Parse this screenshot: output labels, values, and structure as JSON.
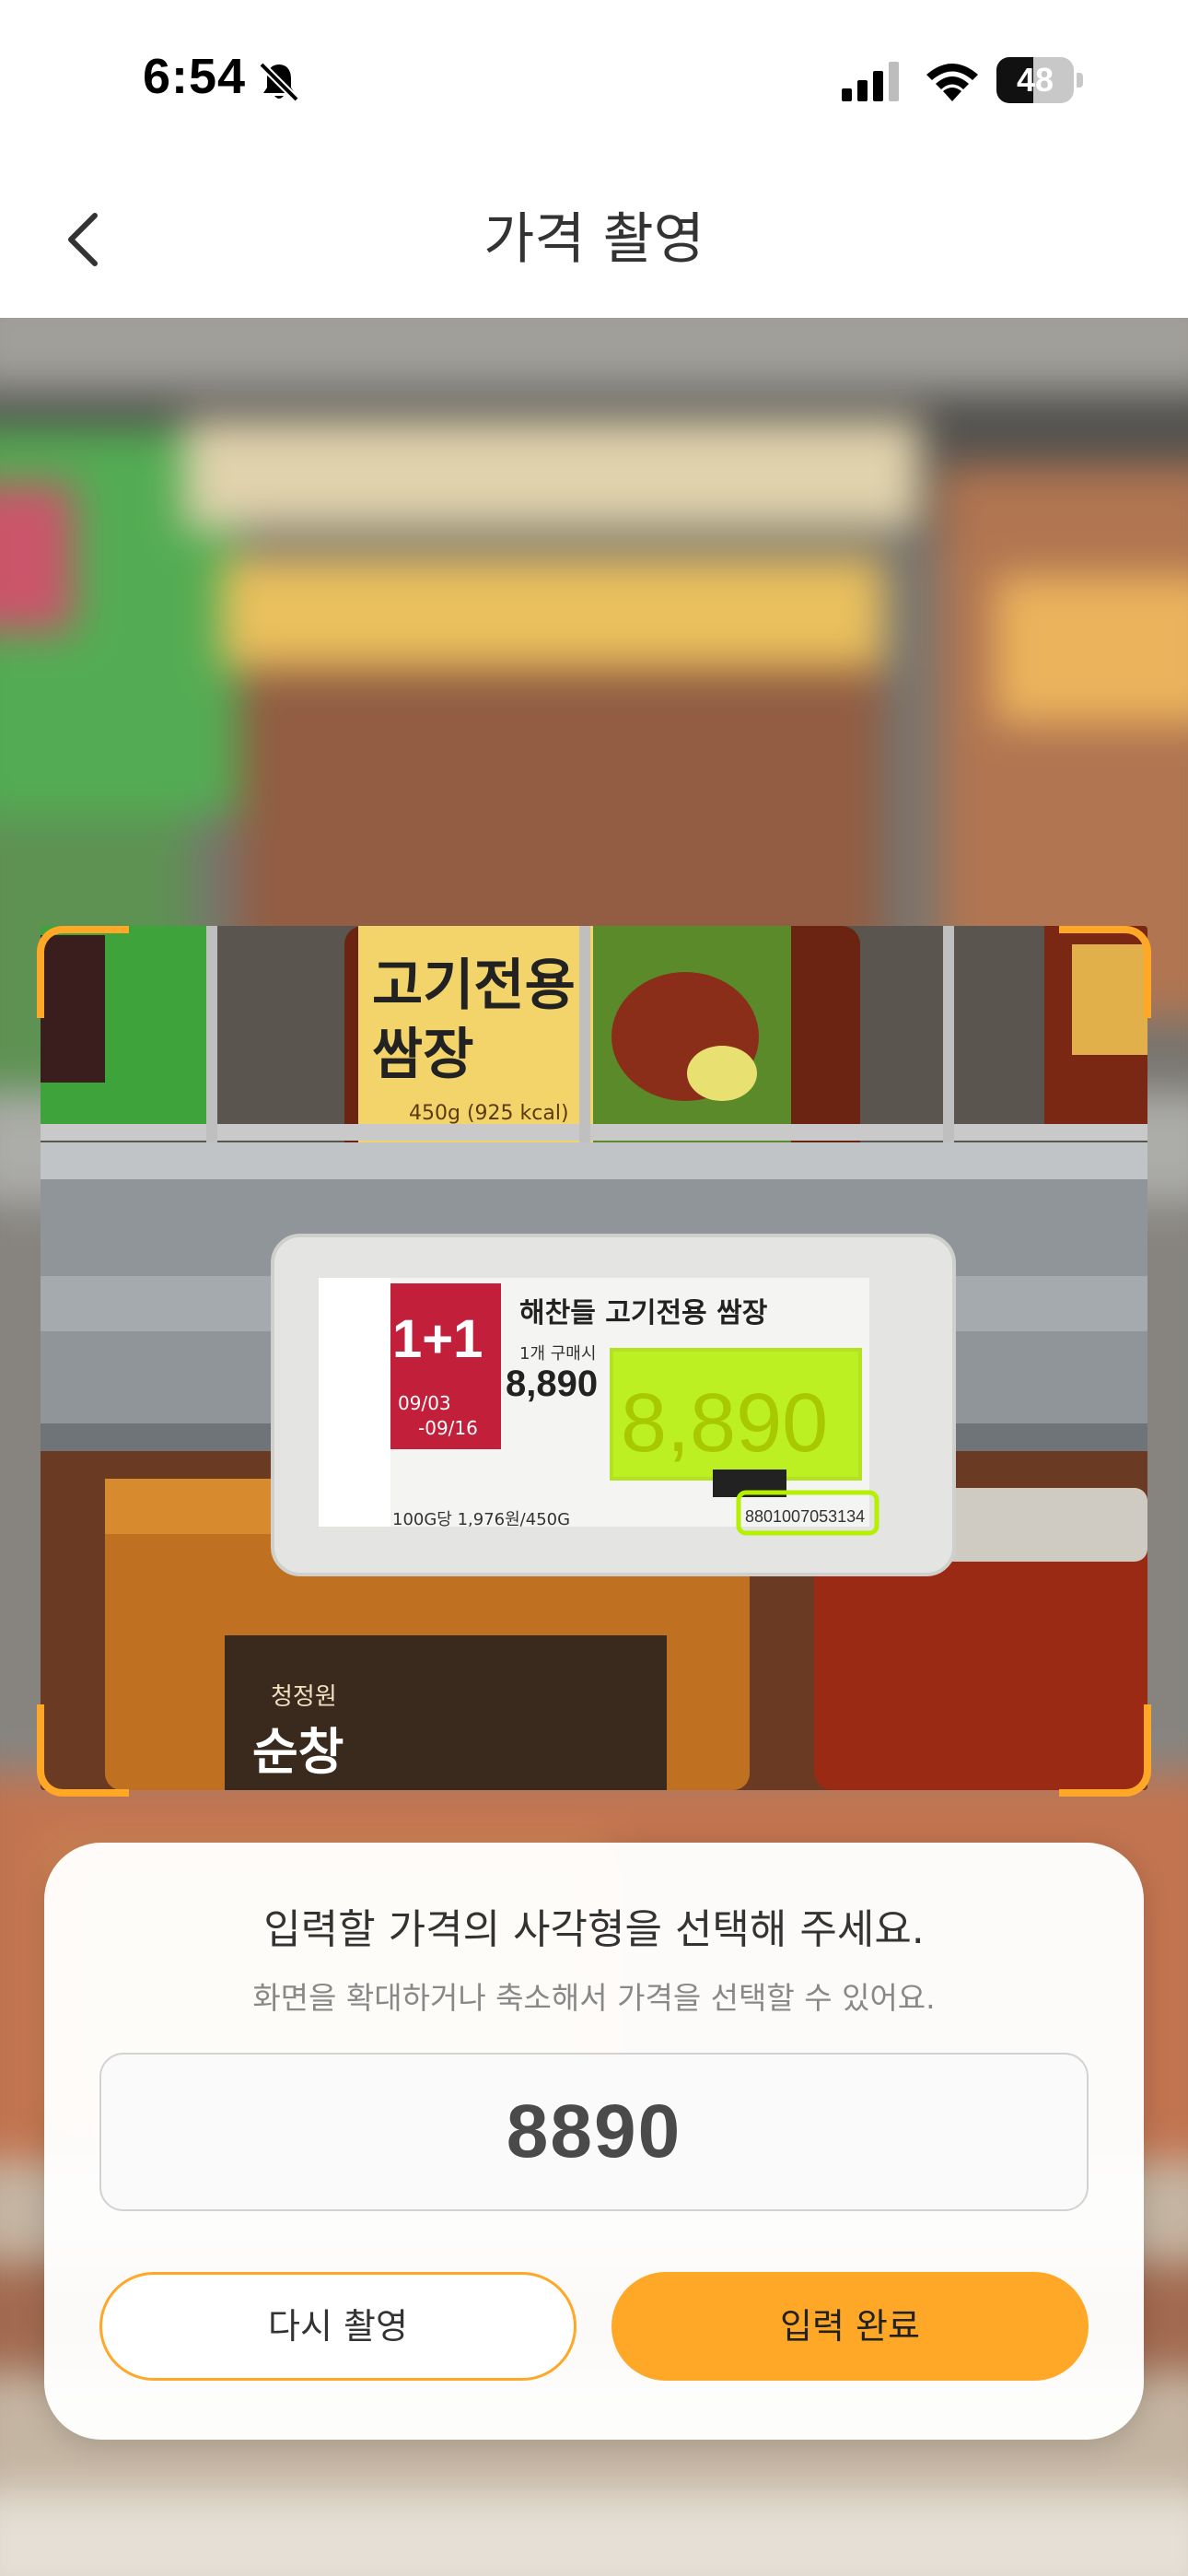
{
  "status_bar": {
    "time": "6:54",
    "battery_level": 48,
    "icons": [
      "bell-slash-icon",
      "cellular-signal-icon",
      "wifi-icon",
      "battery-icon"
    ]
  },
  "nav": {
    "back_icon": "chevron-left-icon",
    "title": "가격 촬영"
  },
  "camera": {
    "label": {
      "product_name": "해찬들 고기전용 쌈장",
      "promo": "1+1",
      "promo_period_start": "09/03",
      "promo_period_end": "-09/16",
      "single_buy_caption": "1개 구매시",
      "single_price": "8,890",
      "big_price": "8,890",
      "unit_price": "100G당 1,976원/450G",
      "barcode": "8801007053134"
    },
    "product_top": {
      "line1": "고기전용",
      "line2": "쌈장",
      "weight": "450g (925 kcal)"
    },
    "product_bottom": {
      "brand": "청정원",
      "name": "순창"
    },
    "colors": {
      "crop_corner": "#ffa726",
      "detected_price_highlight": "#b4f000"
    }
  },
  "sheet": {
    "title": "입력할 가격의 사각형을 선택해 주세요.",
    "subtitle": "화면을 확대하거나 축소해서 가격을 선택할 수 있어요.",
    "price_value": "8890",
    "retake_label": "다시 촬영",
    "done_label": "입력 완료",
    "accent_color": "#ffa726"
  }
}
